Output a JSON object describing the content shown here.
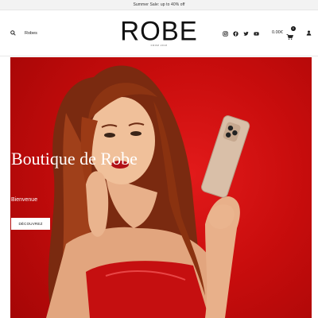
{
  "announcement": {
    "text": "Summer Sale: up to 40% off"
  },
  "header": {
    "search_label": "Robes",
    "logo_text": "ROBE",
    "logo_tagline": "FROM 2018",
    "social_icons": [
      "instagram-icon",
      "facebook-icon",
      "twitter-icon",
      "youtube-icon"
    ],
    "cart_total": "0.00€",
    "cart_count": "0",
    "icons": {
      "search": "search-icon",
      "cart": "cart-icon",
      "account": "user-icon"
    }
  },
  "hero": {
    "title": "Boutique de Robe",
    "subtitle": "Bienvenue",
    "button_label": "DÉCOUVREZ",
    "background_color": "#d20f0f"
  }
}
